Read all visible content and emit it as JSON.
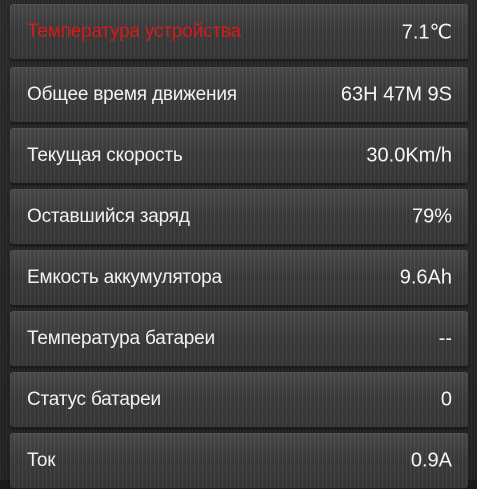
{
  "rows": [
    {
      "label": "Температура устройства",
      "value": "7.1℃",
      "alert": true
    },
    {
      "label": "Общее время движения",
      "value": "63H 47M 9S"
    },
    {
      "label": "Текущая скорость",
      "value": "30.0Km/h"
    },
    {
      "label": "Оставшийся заряд",
      "value": "79%"
    },
    {
      "label": "Емкость аккумулятора",
      "value": "9.6Ah"
    },
    {
      "label": "Температура батареи",
      "value": "--"
    },
    {
      "label": "Статус батареи",
      "value": "0"
    },
    {
      "label": "Ток",
      "value": "0.9A"
    }
  ],
  "colors": {
    "alert_label": "#d61a1a",
    "text": "#f2f2f2"
  }
}
